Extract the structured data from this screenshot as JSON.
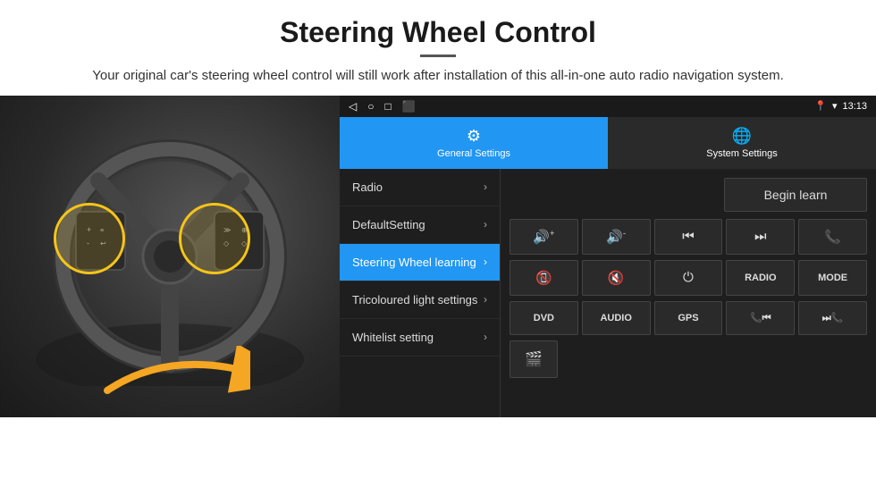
{
  "header": {
    "title": "Steering Wheel Control",
    "subtitle": "Your original car's steering wheel control will still work after installation of this all-in-one auto radio navigation system."
  },
  "statusBar": {
    "time": "13:13",
    "icons": [
      "◁",
      "○",
      "□",
      "⬛"
    ]
  },
  "tabs": [
    {
      "id": "general",
      "label": "General Settings",
      "active": true
    },
    {
      "id": "system",
      "label": "System Settings",
      "active": false
    }
  ],
  "menu": [
    {
      "id": "radio",
      "label": "Radio",
      "active": false
    },
    {
      "id": "default",
      "label": "DefaultSetting",
      "active": false
    },
    {
      "id": "steering",
      "label": "Steering Wheel learning",
      "active": true
    },
    {
      "id": "tricoloured",
      "label": "Tricoloured light settings",
      "active": false
    },
    {
      "id": "whitelist",
      "label": "Whitelist setting",
      "active": false
    }
  ],
  "controls": {
    "beginLearn": "Begin learn",
    "row1": [
      "🔊+",
      "🔊-",
      "⏮",
      "⏭",
      "📞"
    ],
    "row2": [
      "☎",
      "🔇",
      "⏻",
      "RADIO",
      "MODE"
    ],
    "row3": [
      "DVD",
      "AUDIO",
      "GPS",
      "⏮",
      "⏭"
    ],
    "lastRow": [
      "🎬"
    ]
  }
}
